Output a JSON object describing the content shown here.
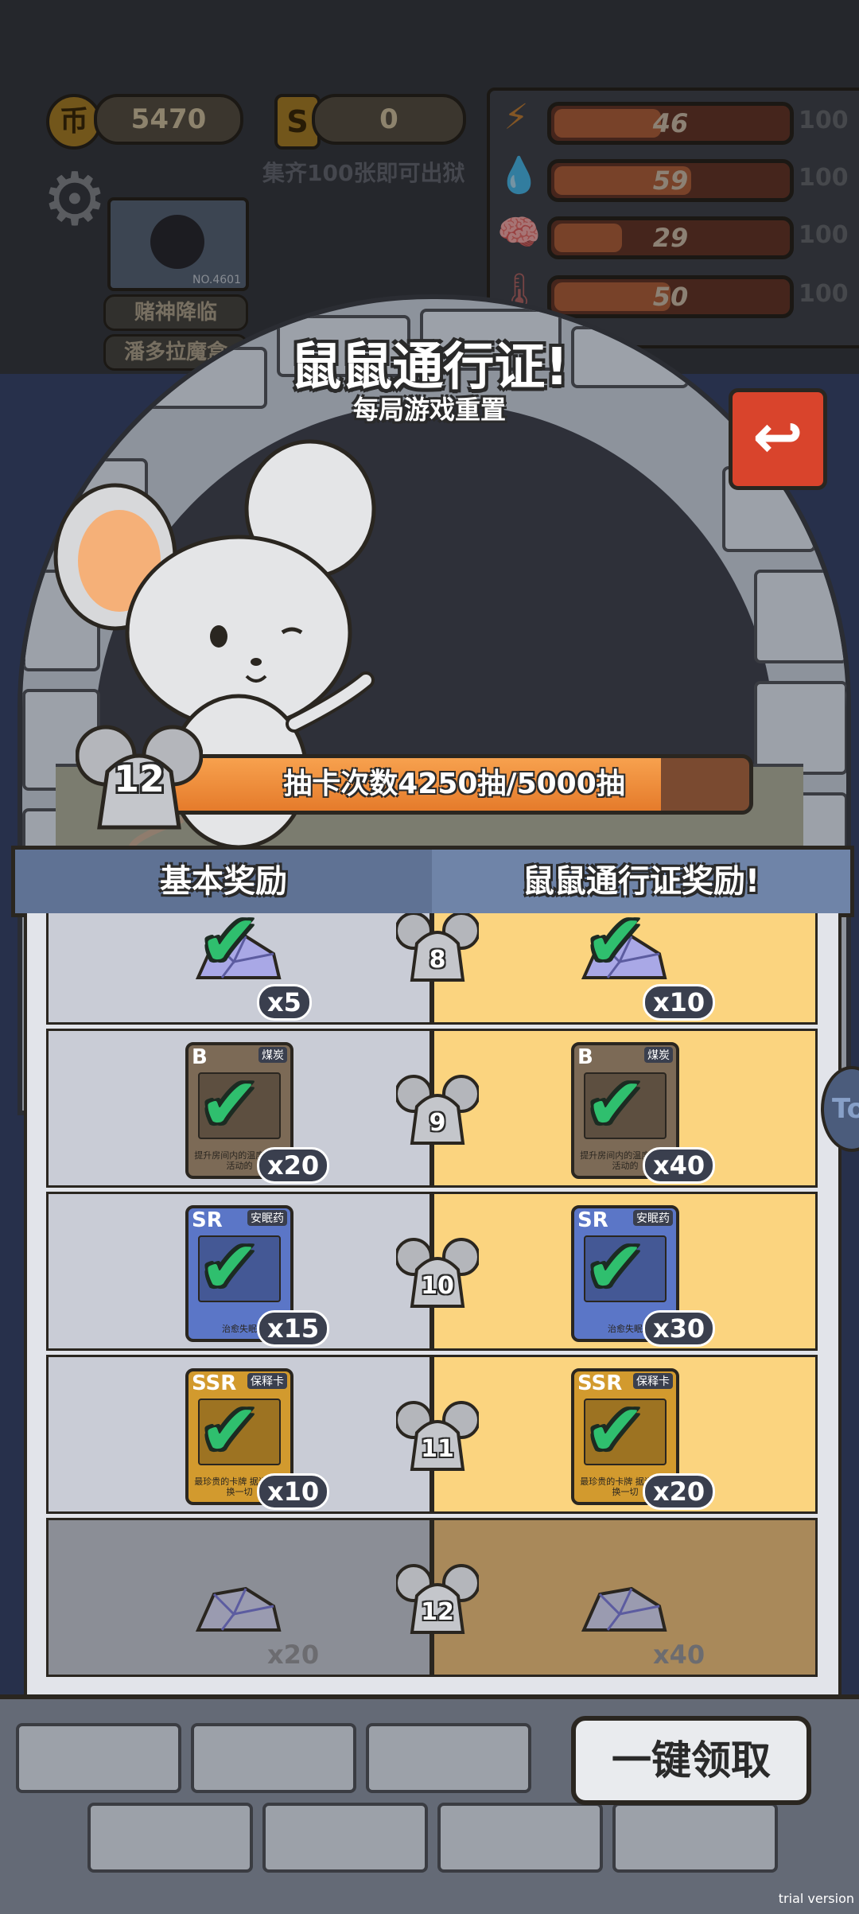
{
  "hud": {
    "coin_icon": "币",
    "coins": "5470",
    "ticket_icon": "S",
    "tickets": "0",
    "collect_hint": "集齐100张即可出狱",
    "avatar_id": "NO.4601",
    "tags": [
      "赌神降临",
      "潘多拉魔盒"
    ],
    "stats": [
      {
        "name": "energy",
        "icon": "lightning-icon",
        "glyph": "⚡",
        "value": "46",
        "max": "100",
        "fill": 0.46,
        "color": "#c9853a"
      },
      {
        "name": "water",
        "icon": "water-drop-icon",
        "glyph": "💧",
        "value": "59",
        "max": "100",
        "fill": 0.59,
        "color": "#5a8fbf"
      },
      {
        "name": "brain",
        "icon": "brain-icon",
        "glyph": "🧠",
        "value": "29",
        "max": "100",
        "fill": 0.29,
        "color": "#7a6aa8"
      },
      {
        "name": "temperature",
        "icon": "thermometer-icon",
        "glyph": "🌡",
        "value": "50",
        "max": "100",
        "fill": 0.5,
        "color": "#b86a6a"
      }
    ]
  },
  "header": {
    "title": "鼠鼠通行证!",
    "subtitle": "每局游戏重置",
    "back_icon": "return-arrow-icon",
    "back_glyph": "↩"
  },
  "progress": {
    "level": "12",
    "text": "抽卡次数4250抽/5000抽",
    "fraction": 0.85
  },
  "tabs": {
    "basic": "基本奖励",
    "pass": "鼠鼠通行证奖励!"
  },
  "rows": [
    {
      "level": "8",
      "claimed": true,
      "basic": {
        "type": "gem",
        "qty": "x5"
      },
      "pass": {
        "type": "gem",
        "qty": "x10"
      }
    },
    {
      "level": "9",
      "claimed": true,
      "basic": {
        "type": "card",
        "rarity": "B",
        "name": "煤炭",
        "desc": "提升房间内的温度 一切活动的",
        "qty": "x20",
        "color": "#7c6a56"
      },
      "pass": {
        "type": "card",
        "rarity": "B",
        "name": "煤炭",
        "desc": "提升房间内的温度 一切活动的",
        "qty": "x40",
        "color": "#7c6a56"
      }
    },
    {
      "level": "10",
      "claimed": true,
      "basic": {
        "type": "card",
        "rarity": "SR",
        "name": "安眠药",
        "desc": "治愈失眠",
        "qty": "x15",
        "color": "#5b76c7"
      },
      "pass": {
        "type": "card",
        "rarity": "SR",
        "name": "安眠药",
        "desc": "治愈失眠",
        "qty": "x30",
        "color": "#5b76c7"
      }
    },
    {
      "level": "11",
      "claimed": true,
      "basic": {
        "type": "card",
        "rarity": "SSR",
        "name": "保释卡",
        "desc": "最珍贵的卡牌 据说能兑换一切",
        "qty": "x10",
        "color": "#d29a2e"
      },
      "pass": {
        "type": "card",
        "rarity": "SSR",
        "name": "保释卡",
        "desc": "最珍贵的卡牌 据说能兑换一切",
        "qty": "x20",
        "color": "#d29a2e"
      }
    },
    {
      "level": "12",
      "claimed": false,
      "basic": {
        "type": "gem",
        "qty": "x20"
      },
      "pass": {
        "type": "gem",
        "qty": "x40"
      }
    }
  ],
  "claim_all": "一键领取",
  "side_tab": "To",
  "watermark": "trial version"
}
